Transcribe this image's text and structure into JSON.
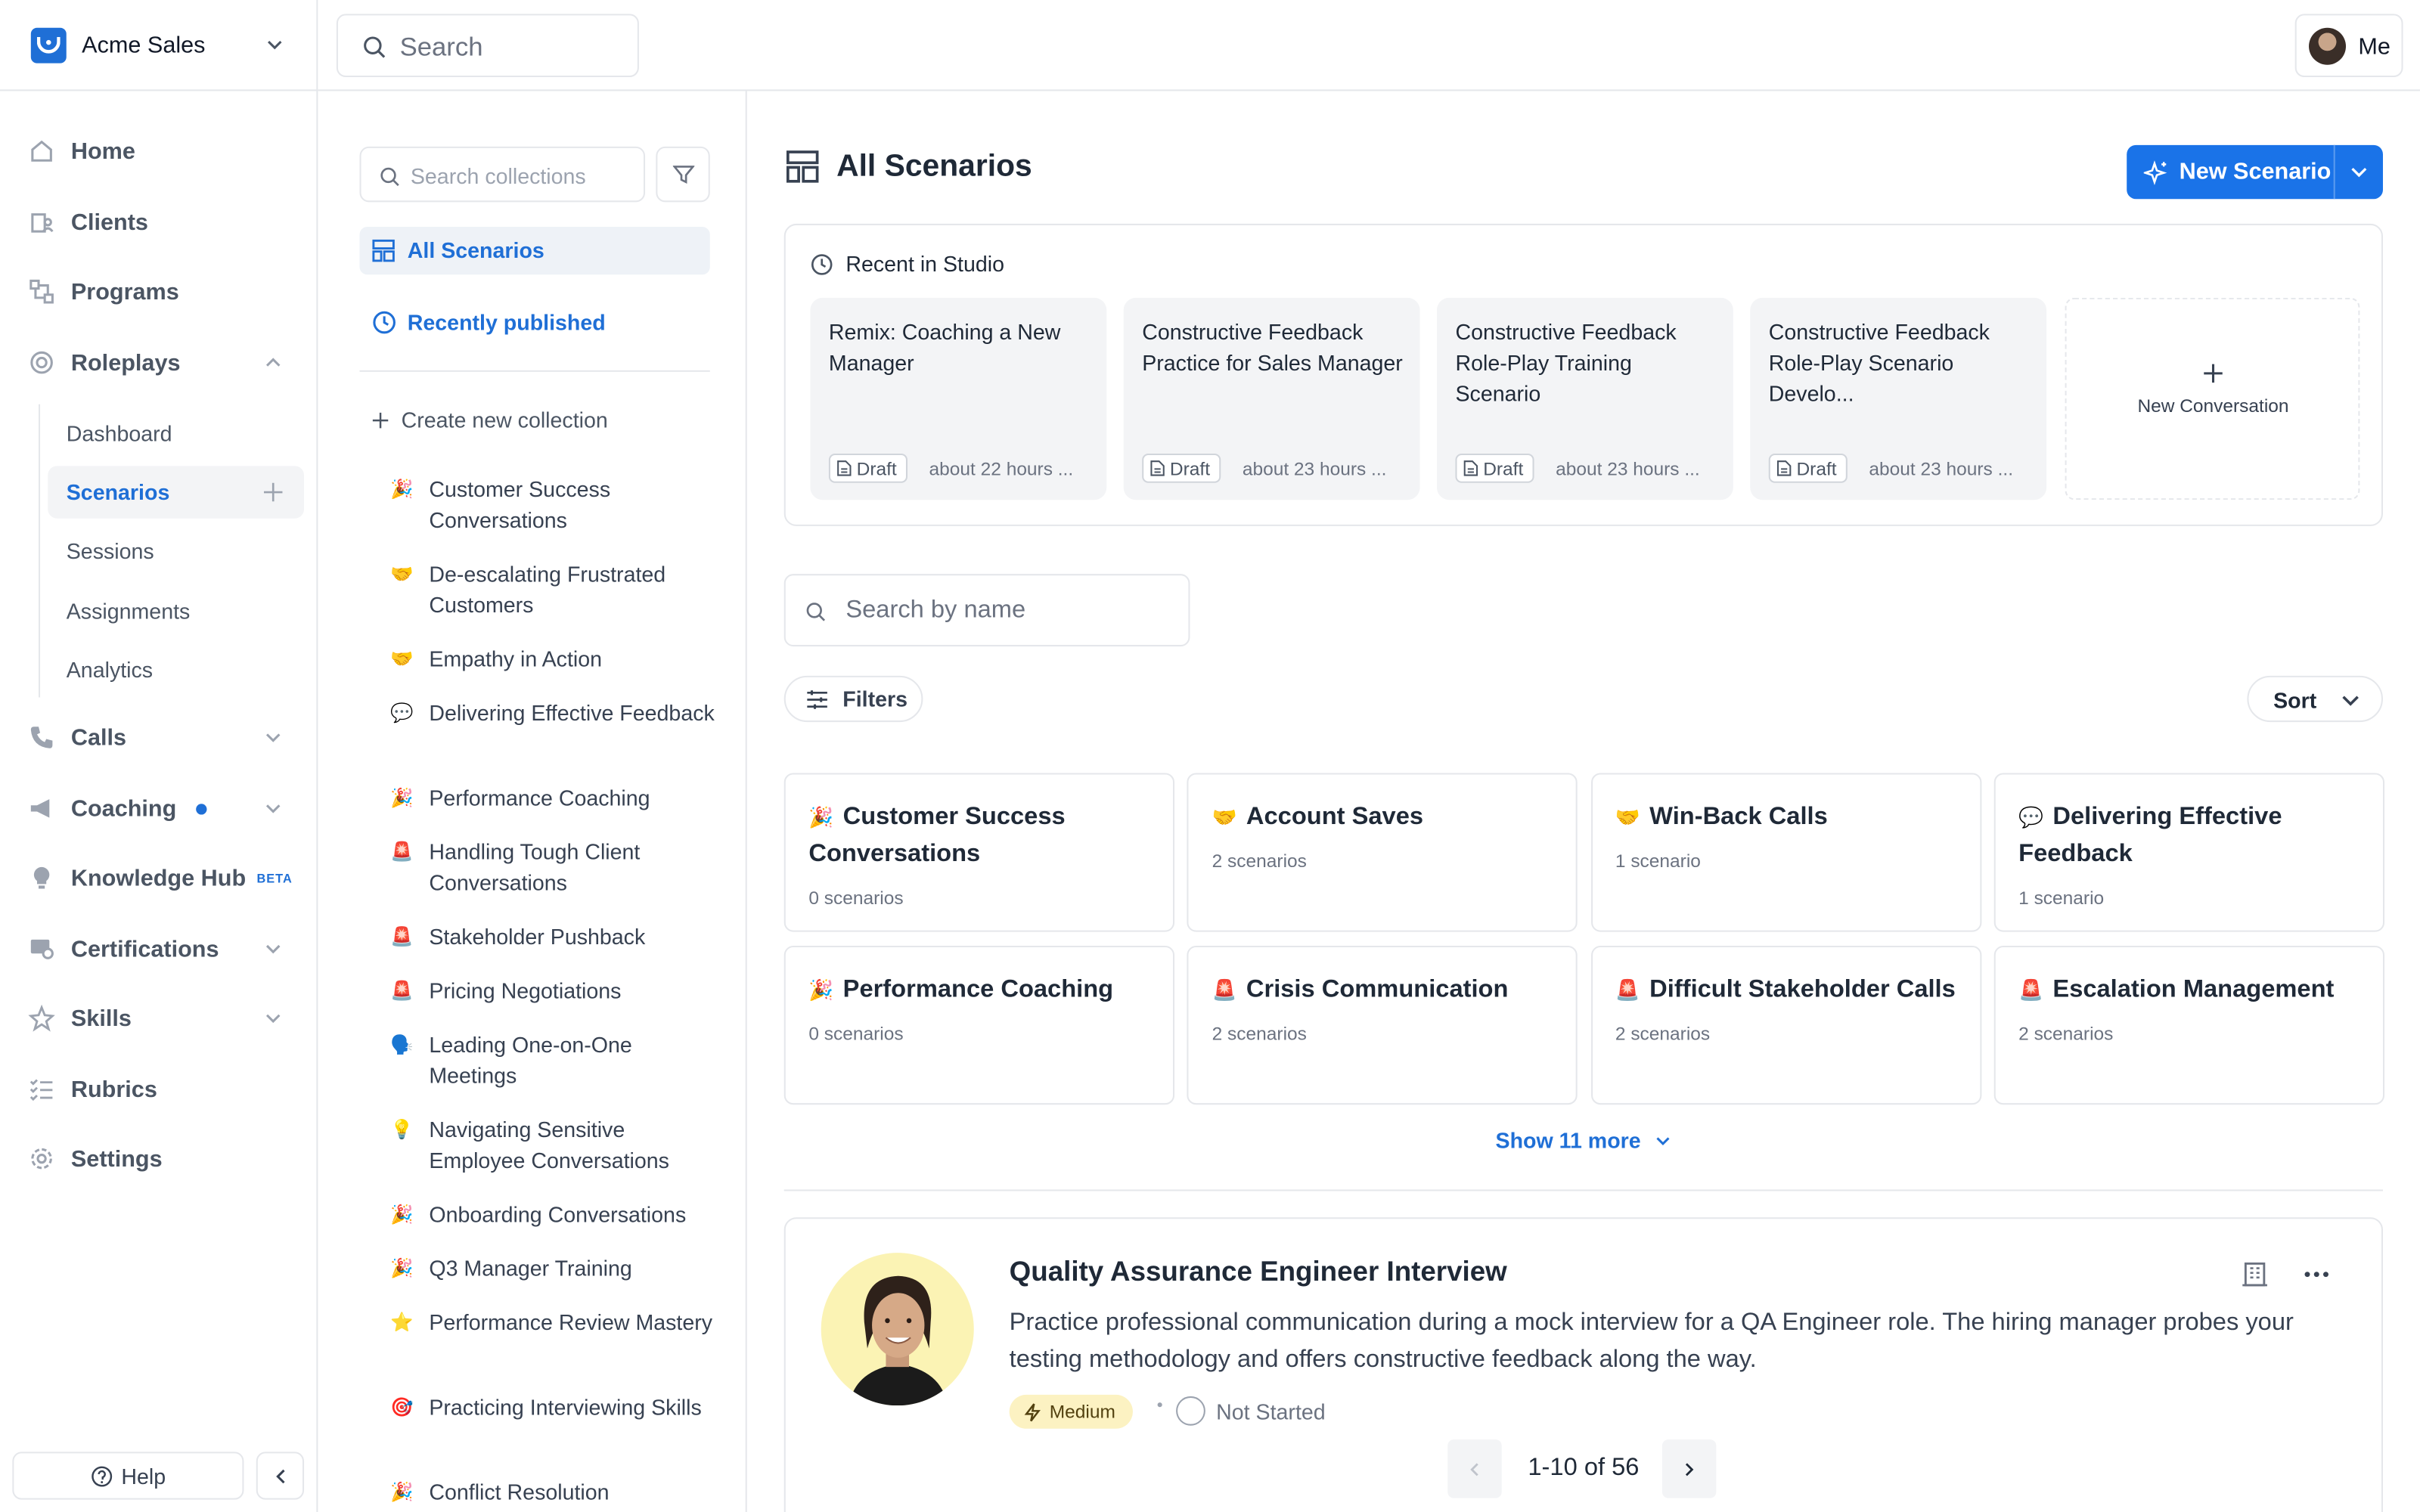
{
  "org": {
    "name": "Acme Sales"
  },
  "search": {
    "placeholder": "Search"
  },
  "user": {
    "label": "Me"
  },
  "nav": {
    "home": "Home",
    "clients": "Clients",
    "programs": "Programs",
    "roleplays": "Roleplays",
    "roleplays_sub": [
      "Dashboard",
      "Scenarios",
      "Sessions",
      "Assignments",
      "Analytics"
    ],
    "calls": "Calls",
    "coaching": "Coaching",
    "knowledge_hub": "Knowledge Hub",
    "beta_badge": "BETA",
    "certifications": "Certifications",
    "skills": "Skills",
    "rubrics": "Rubrics",
    "settings": "Settings",
    "help": "Help"
  },
  "collections": {
    "search_placeholder": "Search collections",
    "all_scenarios": "All Scenarios",
    "recently_published": "Recently published",
    "create_new": "Create new collection",
    "items": [
      {
        "emoji": "🎉",
        "label": "Customer Success Conversations"
      },
      {
        "emoji": "🤝",
        "label": "De-escalating Frustrated Customers"
      },
      {
        "emoji": "🤝",
        "label": "Empathy in Action"
      },
      {
        "emoji": "💬",
        "label": "Delivering Effective Feedback"
      },
      {
        "emoji": "🎉",
        "label": "Performance Coaching"
      },
      {
        "emoji": "🚨",
        "label": "Handling Tough Client Conversations"
      },
      {
        "emoji": "🚨",
        "label": "Stakeholder Pushback"
      },
      {
        "emoji": "🚨",
        "label": "Pricing Negotiations"
      },
      {
        "emoji": "🗣️",
        "label": "Leading One-on-One Meetings"
      },
      {
        "emoji": "💡",
        "label": "Navigating Sensitive Employee Conversations"
      },
      {
        "emoji": "🎉",
        "label": "Onboarding Conversations"
      },
      {
        "emoji": "🎉",
        "label": "Q3 Manager Training"
      },
      {
        "emoji": "⭐",
        "label": "Performance Review Mastery"
      },
      {
        "emoji": "🎯",
        "label": "Practicing Interviewing Skills"
      },
      {
        "emoji": "🎉",
        "label": "Conflict Resolution"
      }
    ]
  },
  "main": {
    "title": "All Scenarios",
    "new_scenario": "New Scenario",
    "recent": {
      "title": "Recent in Studio",
      "cards": [
        {
          "title": "Remix: Coaching a New Manager",
          "status": "Draft",
          "time": "about 22 hours ..."
        },
        {
          "title": "Constructive Feedback Practice for Sales Manager",
          "status": "Draft",
          "time": "about 23 hours ..."
        },
        {
          "title": "Constructive Feedback Role-Play Training Scenario",
          "status": "Draft",
          "time": "about 23 hours ..."
        },
        {
          "title": "Constructive Feedback Role-Play Scenario Develo...",
          "status": "Draft",
          "time": "about 23 hours ..."
        }
      ],
      "new_conversation": "New Conversation"
    },
    "search_placeholder": "Search by name",
    "filters": "Filters",
    "sort": "Sort",
    "collections": [
      {
        "emoji": "🎉",
        "title": "Customer Success Conversations",
        "count": "0 scenarios"
      },
      {
        "emoji": "🤝",
        "title": "Account Saves",
        "count": "2 scenarios"
      },
      {
        "emoji": "🤝",
        "title": "Win-Back Calls",
        "count": "1 scenario"
      },
      {
        "emoji": "💬",
        "title": "Delivering Effective Feedback",
        "count": "1 scenario"
      },
      {
        "emoji": "🎉",
        "title": "Performance Coaching",
        "count": "0 scenarios"
      },
      {
        "emoji": "🚨",
        "title": "Crisis Communication",
        "count": "2 scenarios"
      },
      {
        "emoji": "🚨",
        "title": "Difficult Stakeholder Calls",
        "count": "2 scenarios"
      },
      {
        "emoji": "🚨",
        "title": "Escalation Management",
        "count": "2 scenarios"
      }
    ],
    "show_more": "Show 11 more",
    "scenario": {
      "title": "Quality Assurance Engineer Interview",
      "description": "Practice professional communication during a mock interview for a QA Engineer role. The hiring manager probes your testing methodology and offers constructive feedback along the way.",
      "difficulty": "Medium",
      "status": "Not Started"
    },
    "pagination": "1-10 of 56"
  },
  "colors": {
    "accent": "#1f6fd6",
    "border": "#e5e7eb",
    "active_bg": "#eef2f7"
  }
}
